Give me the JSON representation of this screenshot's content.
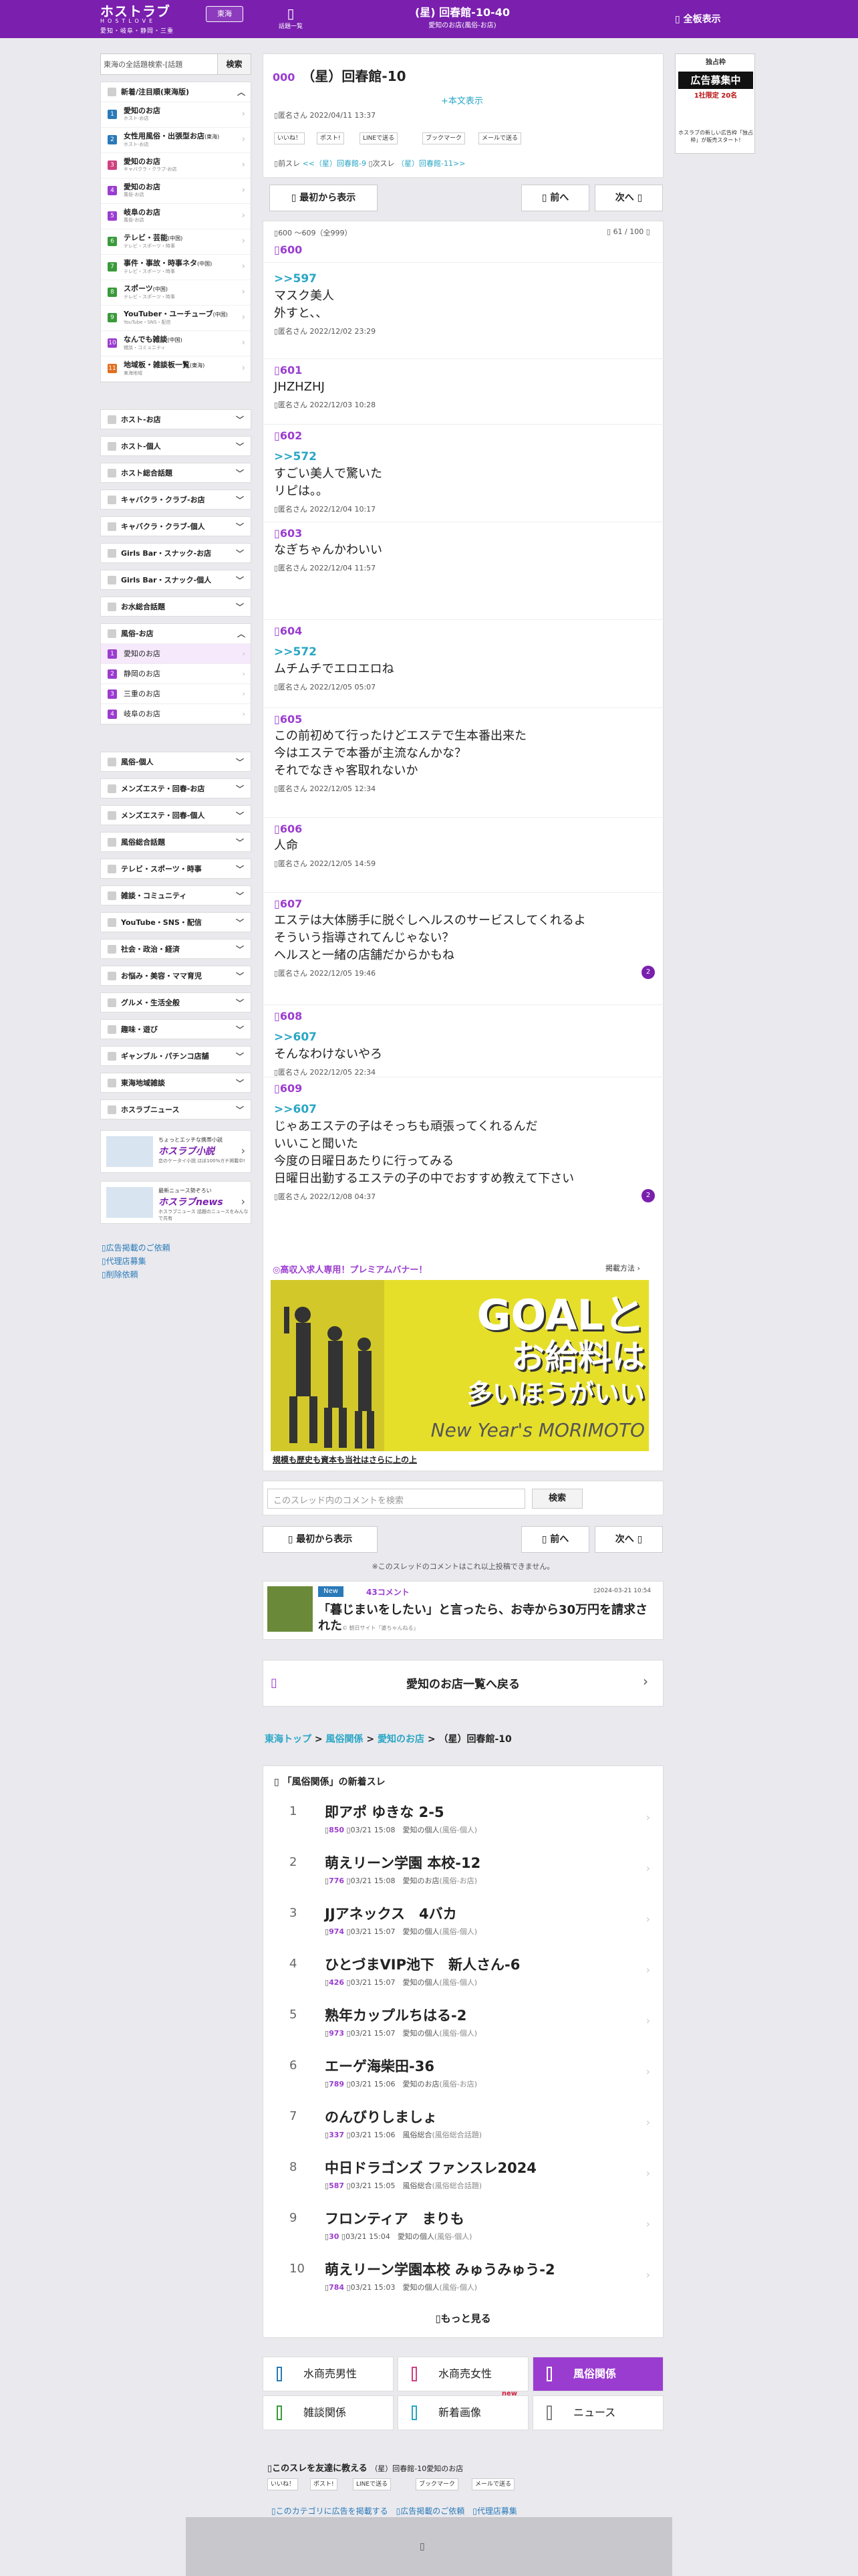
{
  "header": {
    "logo": "ホストラブ",
    "logo_sub": "HOSTLOVE",
    "region_desc": "愛知・岐阜・静岡・三重",
    "region_button": "東海",
    "nav_label": "話題一覧",
    "thread_title": "(星) 回春館-10-40",
    "thread_sub": "愛知のお店(風俗-お店)",
    "full_view": "全板表示"
  },
  "sidebar": {
    "search_placeholder": "東海の全話題検索-[話題",
    "search_button": "検索",
    "head": "新着/注目順(東海版)",
    "items": [
      {
        "no": "1",
        "name": "愛知のお店",
        "desc": "ホスト-お店",
        "color": "#2a7ab8"
      },
      {
        "no": "2",
        "name": "女性用風俗・出張型お店",
        "tag": "(東海)",
        "desc": "ホスト-お店",
        "color": "#2a7ab8"
      },
      {
        "no": "3",
        "name": "愛知のお店",
        "desc": "キャバクラ・クラブ-お店",
        "color": "#d04080"
      },
      {
        "no": "4",
        "name": "愛知のお店",
        "desc": "風俗-お店",
        "color": "#9b3cd0"
      },
      {
        "no": "5",
        "name": "岐阜のお店",
        "desc": "風俗-お店",
        "color": "#9b3cd0"
      },
      {
        "no": "6",
        "name": "テレビ・芸能",
        "tag": "(中国)",
        "desc": "テレビ・スポーツ・時事",
        "color": "#3a9a3a"
      },
      {
        "no": "7",
        "name": "事件・事故・時事ネタ",
        "tag": "(中国)",
        "desc": "テレビ・スポーツ・時事",
        "color": "#3a9a3a"
      },
      {
        "no": "8",
        "name": "スポーツ",
        "tag": "(中国)",
        "desc": "テレビ・スポーツ・時事",
        "color": "#3a9a3a"
      },
      {
        "no": "9",
        "name": "YouTuber・ユーチューブ",
        "tag": "(中国)",
        "desc": "YouTube・SNS・配信",
        "color": "#3a9a3a"
      },
      {
        "no": "10",
        "name": "なんでも雑談",
        "tag": "(中国)",
        "desc": "雑談・コミュニティ",
        "color": "#9b3cd0"
      },
      {
        "no": "11",
        "name": "地域板・雑談板一覧",
        "tag": "(東海)",
        "desc": "東海地域",
        "color": "#e07020"
      }
    ],
    "cats_a": [
      "ホスト-お店",
      "ホスト-個人",
      "ホスト総合話題",
      "キャバクラ・クラブ-お店",
      "キャバクラ・クラブ-個人",
      "Girls Bar・スナック-お店",
      "Girls Bar・スナック-個人",
      "お水総合話題"
    ],
    "fuzoku_head": "風俗-お店",
    "fuzoku_items": [
      {
        "no": "1",
        "name": "愛知のお店"
      },
      {
        "no": "2",
        "name": "静岡のお店"
      },
      {
        "no": "3",
        "name": "三重のお店"
      },
      {
        "no": "4",
        "name": "岐阜のお店"
      }
    ],
    "cats_b": [
      "風俗-個人",
      "メンズエステ・回春-お店",
      "メンズエステ・回春-個人",
      "風俗総合話題",
      "テレビ・スポーツ・時事",
      "雑談・コミュニティ",
      "YouTube・SNS・配信",
      "社会・政治・経済",
      "お悩み・美容・ママ育児",
      "グルメ・生活全般",
      "趣味・遊び",
      "ギャンブル・パチンコ店舗",
      "東海地域雑談",
      "ホスラブニュース"
    ],
    "banner1": {
      "t1": "ちょっとエッチな携帯小説",
      "t2": "ホスラブ小説",
      "t3": "恋のケータイ小説 ほぼ100%ガチ掲載中!"
    },
    "banner2": {
      "t1": "最新ニュース勢ぞろい",
      "t2": "ホスラブnews",
      "t3": "ホスラブニュース 話題のニュースをみんなで共有"
    },
    "links": [
      "広告掲載のご依頼",
      "代理店募集",
      "削除依頼"
    ]
  },
  "ad": {
    "a1": "独占枠",
    "a2": "広告募集中",
    "a3": "1社限定 20名",
    "a4": "ホスラブの新しい広告枠「独占枠」が販売スタート!"
  },
  "thread": {
    "no": "000",
    "title": "（星）回春館-10",
    "more_text": "+本文表示",
    "author": "匿名さん 2022/04/11 13:37",
    "shares": [
      "いいね！",
      "ポスト!",
      "LINEで送る",
      "ブックマーク",
      "メールで送る"
    ],
    "nav_text_prev": "前スレ",
    "nav_prev": "<<（星）回春館-9",
    "nav_text_next": "次スレ",
    "nav_next": "（星）回春館-11>>",
    "btn_first": "最初から表示",
    "btn_prev": "前へ",
    "btn_next": "次へ",
    "range": "600 〜609（全999）",
    "pages": "61 / 100"
  },
  "posts": [
    {
      "no": "600",
      "ref": "",
      "body": [],
      "meta": ""
    },
    {
      "no": "",
      "ref": ">>597",
      "body": [
        "マスク美人",
        "外すと、、"
      ],
      "meta": "匿名さん 2022/12/02 23:29"
    },
    {
      "no": "601",
      "ref": "",
      "body": [
        "JHZHZHJ"
      ],
      "meta": "匿名さん 2022/12/03 10:28"
    },
    {
      "no": "602",
      "ref": ">>572",
      "body": [
        "すごい美人で驚いた",
        "リピは。。"
      ],
      "meta": "匿名さん 2022/12/04 10:17"
    },
    {
      "no": "603",
      "ref": "",
      "body": [
        "なぎちゃんかわいい"
      ],
      "meta": "匿名さん 2022/12/04 11:57"
    },
    {
      "no": "604",
      "ref": ">>572",
      "body": [
        "ムチムチでエロエロね"
      ],
      "meta": "匿名さん 2022/12/05 05:07"
    },
    {
      "no": "605",
      "ref": "",
      "body": [
        "この前初めて行ったけどエステで生本番出来た",
        "今はエステで本番が主流なんかな？",
        "それでなきゃ客取れないか"
      ],
      "meta": "匿名さん 2022/12/05 12:34"
    },
    {
      "no": "606",
      "ref": "",
      "body": [
        "人命"
      ],
      "meta": "匿名さん 2022/12/05 14:59"
    },
    {
      "no": "607",
      "ref": "",
      "body": [
        "エステは大体勝手に脱ぐしヘルスのサービスしてくれるよ",
        "そういう指導されてんじゃない？",
        "ヘルスと一緒の店舗だからかもね"
      ],
      "meta": "匿名さん 2022/12/05 19:46",
      "badge": "2"
    },
    {
      "no": "608",
      "ref": ">>607",
      "body": [
        "そんなわけないやろ"
      ],
      "meta": "匿名さん 2022/12/05 22:34"
    },
    {
      "no": "609",
      "ref": ">>607",
      "body": [
        "じゃあエステの子はそっちも頑張ってくれるんだ",
        "いいこと聞いた",
        "今度の日曜日あたりに行ってみる",
        "日曜日出勤するエステの子の中でおすすめ教えて下さい"
      ],
      "meta": "匿名さん 2022/12/08 04:37",
      "badge": "2"
    }
  ],
  "premium": {
    "label": "◎高収入求人専用！プレミアムバナー！",
    "how": "掲載方法",
    "line1": "GOALと",
    "line2": "お給料は",
    "line3": "多いほうがいい",
    "brand": "New Year's MORIMOTO",
    "caption": "規模も歴史も資本も当社はさらに上の上"
  },
  "comment_search": {
    "placeholder": "このスレッド内のコメントを検索",
    "button": "検索"
  },
  "end_note": "※このスレッドのコメントはこれ以上投稿できません。",
  "news": {
    "badge": "New",
    "count": "43コメント",
    "date": "2024-03-21 10:54",
    "title": "「暮じまいをしたい」と言ったら、お寺から30万円を請求された",
    "source": "© 朝日サイト「婆ちゃんねる」"
  },
  "back_link": "愛知のお店一覧へ戻る",
  "breadcrumb": {
    "a": "東海トップ",
    "b": "風俗関係",
    "c": "愛知のお店",
    "d": "（星）回春館-10"
  },
  "ranking": {
    "head": "「風俗関係」の新着スレ",
    "rows": [
      {
        "rk": "1",
        "title": "即アポ ゆきな 2-5",
        "res": "850",
        "time": "03/21 15:08",
        "cat": "愛知の個人",
        "sub": "(風俗-個人)"
      },
      {
        "rk": "2",
        "title": "萌えリーン学園 本校-12",
        "res": "776",
        "time": "03/21 15:08",
        "cat": "愛知のお店",
        "sub": "(風俗-お店)"
      },
      {
        "rk": "3",
        "title": "JJアネックス　4バカ",
        "res": "974",
        "time": "03/21 15:07",
        "cat": "愛知の個人",
        "sub": "(風俗-個人)"
      },
      {
        "rk": "4",
        "title": "ひとづまVIP池下　新人さん-6",
        "res": "426",
        "time": "03/21 15:07",
        "cat": "愛知の個人",
        "sub": "(風俗-個人)"
      },
      {
        "rk": "5",
        "title": "熟年カップルちはる-2",
        "res": "973",
        "time": "03/21 15:07",
        "cat": "愛知の個人",
        "sub": "(風俗-個人)"
      },
      {
        "rk": "6",
        "title": "エーゲ海柴田-36",
        "res": "789",
        "time": "03/21 15:06",
        "cat": "愛知のお店",
        "sub": "(風俗-お店)"
      },
      {
        "rk": "7",
        "title": "のんびりしましょ",
        "res": "337",
        "time": "03/21 15:06",
        "cat": "風俗総合",
        "sub": "(風俗総合話題)"
      },
      {
        "rk": "8",
        "title": "中日ドラゴンズ ファンスレ2024",
        "res": "587",
        "time": "03/21 15:05",
        "cat": "風俗総合",
        "sub": "(風俗総合話題)"
      },
      {
        "rk": "9",
        "title": "フロンティア　まりも",
        "res": "30",
        "time": "03/21 15:04",
        "cat": "愛知の個人",
        "sub": "(風俗-個人)"
      },
      {
        "rk": "10",
        "title": "萌えリーン学園本校 みゅうみゅう-2",
        "res": "784",
        "time": "03/21 15:03",
        "cat": "愛知の個人",
        "sub": "(風俗-個人)"
      }
    ],
    "more": "もっと見る"
  },
  "cat_tabs": [
    {
      "label": "水商売男性",
      "color": "#2a7ab8"
    },
    {
      "label": "水商売女性",
      "color": "#d04080"
    },
    {
      "label": "風俗関係",
      "color": "#ffffff",
      "on": true
    },
    {
      "label": "雑談関係",
      "color": "#3a9a3a"
    },
    {
      "label": "新着画像",
      "color": "#2aa6c5",
      "new": "new"
    },
    {
      "label": "ニュース",
      "color": "#888888"
    }
  ],
  "footer": {
    "tell": "このスレを友達に教える",
    "tell_sub": "（星）回春館-10愛知のお店",
    "links": [
      "このカテゴリに広告を掲載する",
      "広告掲載のご依頼",
      "代理店募集"
    ]
  }
}
